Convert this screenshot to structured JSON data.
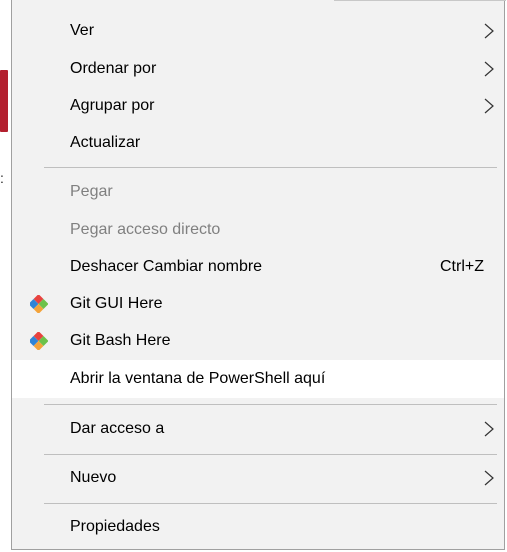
{
  "menu": {
    "items": [
      {
        "label": "Ver",
        "submenu": true
      },
      {
        "label": "Ordenar por",
        "submenu": true
      },
      {
        "label": "Agrupar por",
        "submenu": true
      },
      {
        "label": "Actualizar"
      },
      {
        "label": "Pegar",
        "disabled": true
      },
      {
        "label": "Pegar acceso directo",
        "disabled": true
      },
      {
        "label": "Deshacer Cambiar nombre",
        "shortcut": "Ctrl+Z"
      },
      {
        "label": "Git GUI Here",
        "icon": "git-icon"
      },
      {
        "label": "Git Bash Here",
        "icon": "git-icon"
      },
      {
        "label": "Abrir la ventana de PowerShell aquí",
        "highlighted": true
      },
      {
        "label": "Dar acceso a",
        "submenu": true
      },
      {
        "label": "Nuevo",
        "submenu": true
      },
      {
        "label": "Propiedades"
      }
    ]
  },
  "background": {
    "left_edge_text": ":"
  },
  "colors": {
    "menu_bg": "#f2f2f2",
    "highlight_bg": "#ffffff",
    "disabled_text": "#808080",
    "separator": "#bfbfbf",
    "git_icon_red": "#e8433f",
    "git_icon_green": "#6cc24a",
    "git_icon_blue": "#2f84d6",
    "git_icon_orange": "#f3a33a"
  }
}
